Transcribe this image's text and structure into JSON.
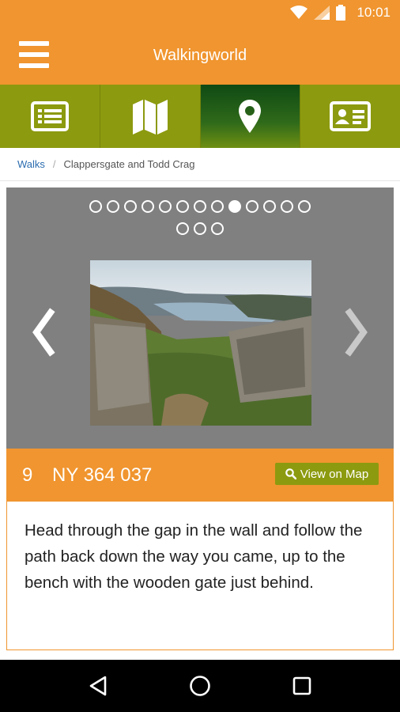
{
  "status_bar": {
    "time": "10:01",
    "icons": [
      "wifi-icon",
      "signal-icon",
      "battery-icon"
    ]
  },
  "app_bar": {
    "title": "Walkingworld",
    "menu_icon": "menu-icon"
  },
  "tabs": [
    {
      "icon": "list-icon",
      "active": false
    },
    {
      "icon": "map-icon",
      "active": false
    },
    {
      "icon": "location-pin-icon",
      "active": true
    },
    {
      "icon": "contact-card-icon",
      "active": false
    }
  ],
  "breadcrumb": {
    "root": "Walks",
    "separator": "/",
    "current": "Clappersgate and Todd Crag"
  },
  "gallery": {
    "total_images": 16,
    "active_index": 9,
    "prev_icon": "chevron-left-icon",
    "next_icon": "chevron-right-icon"
  },
  "step": {
    "number": "9",
    "grid_ref": "NY 364 037",
    "map_button_label": "View on Map",
    "map_button_icon": "search-icon"
  },
  "description": "Head through the gap in the wall and follow the path back down the way you came, up to the bench with the wooden gate just behind.",
  "nav_bar": [
    "back-icon",
    "home-icon",
    "recents-icon"
  ],
  "colors": {
    "accent_orange": "#f0952f",
    "tab_green": "#8c9a0f",
    "tab_active": "#1f5a16"
  }
}
